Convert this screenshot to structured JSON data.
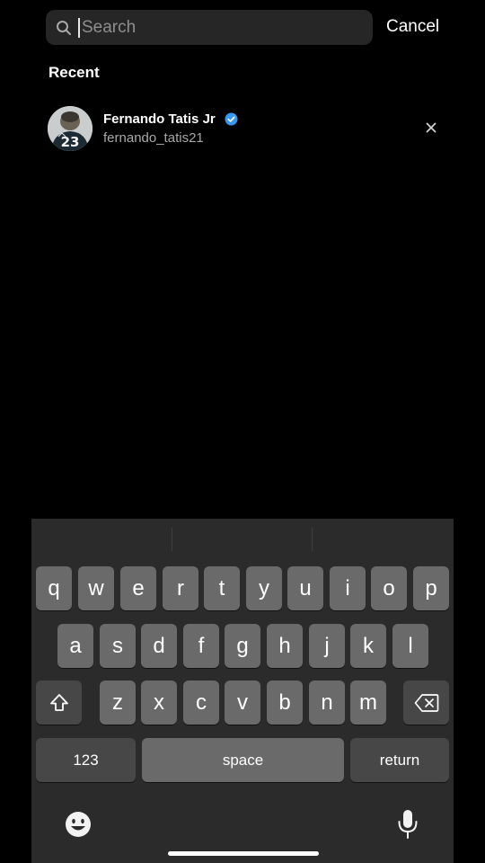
{
  "search": {
    "placeholder": "Search",
    "value": "",
    "cancel_label": "Cancel"
  },
  "recent": {
    "title": "Recent",
    "items": [
      {
        "name": "Fernando Tatis Jr",
        "username": "fernando_tatis21",
        "verified": true,
        "avatar_number": "23"
      }
    ]
  },
  "keyboard": {
    "row1": [
      "q",
      "w",
      "e",
      "r",
      "t",
      "y",
      "u",
      "i",
      "o",
      "p"
    ],
    "row2": [
      "a",
      "s",
      "d",
      "f",
      "g",
      "h",
      "j",
      "k",
      "l"
    ],
    "row3": [
      "z",
      "x",
      "c",
      "v",
      "b",
      "n",
      "m"
    ],
    "numbers_label": "123",
    "space_label": "space",
    "return_label": "return",
    "icons": {
      "shift": "shift-icon",
      "backspace": "backspace-icon",
      "emoji": "emoji-icon",
      "microphone": "microphone-icon"
    }
  },
  "colors": {
    "background": "#000000",
    "search_field": "#262626",
    "keyboard_bg": "#2b2b2b",
    "key": "#6a6a6a",
    "key_dark": "#474747",
    "verified": "#3897f0",
    "secondary_text": "#a8a8a8"
  }
}
